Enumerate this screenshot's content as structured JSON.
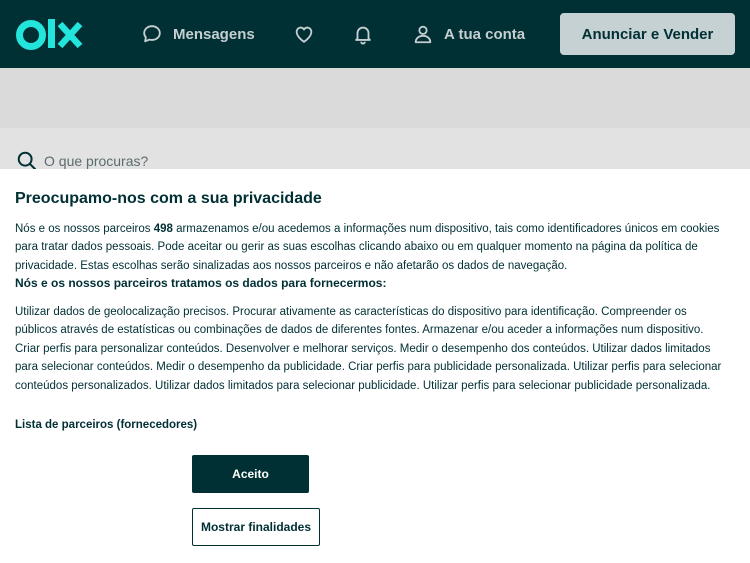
{
  "header": {
    "logo_text": "olx",
    "messages_label": "Mensagens",
    "account_label": "A tua conta",
    "sell_button": "Anunciar e Vender"
  },
  "search": {
    "placeholder": "O que procuras?"
  },
  "consent": {
    "title": "Preocupamo-nos com a sua privacidade",
    "intro_before": "Nós e os nossos parceiros ",
    "partner_count": "498",
    "intro_after": " armazenamos e/ou acedemos a informações num dispositivo, tais como identificadores únicos em cookies para tratar dados pessoais. Pode aceitar ou gerir as suas escolhas clicando abaixo ou em qualquer momento na página da política de privacidade. Estas escolhas serão sinalizadas aos nossos parceiros e não afetarão os dados de navegação.",
    "subtitle": "Nós e os nossos parceiros tratamos os dados para fornecermos:",
    "purposes": "Utilizar dados de geolocalização precisos. Procurar ativamente as características do dispositivo para identificação. Compreender os públicos através de estatísticas ou combinações de dados de diferentes fontes. Armazenar e/ou aceder a informações num dispositivo. Criar perfis para personalizar conteúdos. Desenvolver e melhorar serviços. Medir o desempenho dos conteúdos. Utilizar dados limitados para selecionar conteúdos. Medir o desempenho da publicidade. Criar perfis para publicidade personalizada. Utilizar perfis para selecionar conteúdos personalizados. Utilizar dados limitados para selecionar publicidade. Utilizar perfis para selecionar publicidade personalizada.",
    "partners_link": "Lista de parceiros (fornecedores)",
    "accept_button": "Aceito",
    "purposes_button": "Mostrar finalidades"
  },
  "colors": {
    "brand_dark": "#002f34",
    "logo_teal": "#23e5db",
    "sell_button_bg": "#c6d1d3"
  },
  "icons": [
    "chat-bubble-icon",
    "heart-icon",
    "bell-icon",
    "user-icon",
    "search-icon"
  ]
}
